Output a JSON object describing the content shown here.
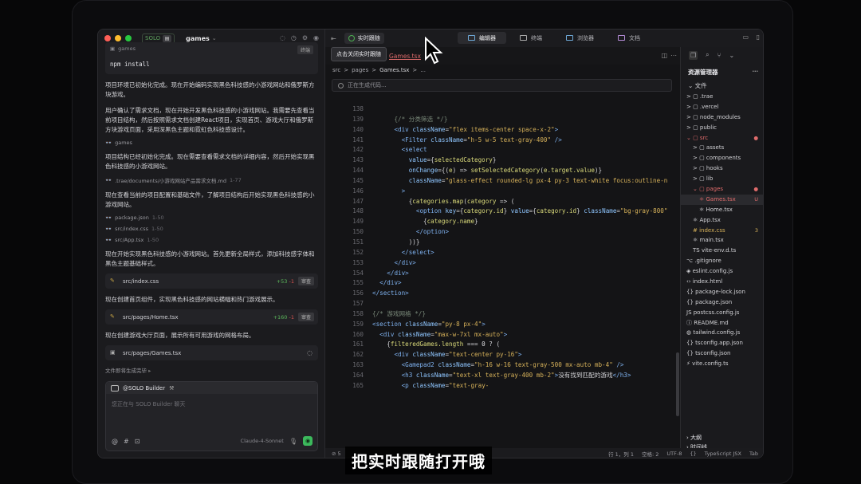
{
  "chat": {
    "title": "games",
    "solo": "SOLO",
    "code_block": {
      "label": "games",
      "copy": "终端",
      "command": "npm install"
    },
    "messages": [
      {
        "kind": "para",
        "text": "项目环境已初始化完成。现在开始编码实现黑色科技感的小游戏网站和俄罗斯方块游戏。"
      },
      {
        "kind": "para",
        "text": "用户确认了需求文档，现在开始开发黑色科技感的小游戏网站。我需要先查看当前项目结构，然后按照需求文档创建React项目，实现首页、游戏大厅和俄罗斯方块游戏页面，采用深黑色主题和霓虹色科技感设计。"
      },
      {
        "kind": "ref",
        "text": "games",
        "lines": ""
      },
      {
        "kind": "para",
        "text": "项目结构已经初始化完成。现在需要查看需求文档的详细内容，然后开始实现黑色科技感的小游戏网站。"
      },
      {
        "kind": "ref",
        "text": ".trae/documents/小游戏网站产品需求文档.md",
        "lines": "1-77"
      },
      {
        "kind": "para",
        "text": "现在查看当前的项目配置和基础文件，了解项目结构后开始实现黑色科技感的小游戏网站。"
      },
      {
        "kind": "ref",
        "text": "package.json",
        "lines": "1-50"
      },
      {
        "kind": "ref",
        "text": "src/index.css",
        "lines": "1-50"
      },
      {
        "kind": "ref",
        "text": "src/App.tsx",
        "lines": "1-50"
      },
      {
        "kind": "para",
        "text": "现在开始实现黑色科技感的小游戏网站。首先更新全局样式，添加科技感字体和黑色主题基础样式。"
      },
      {
        "kind": "file",
        "text": "src/index.css",
        "add": "+53",
        "del": "-1",
        "review": "审查"
      },
      {
        "kind": "para",
        "text": "现在创建首页组件，实现黑色科技感的网站横幅和热门游戏展示。"
      },
      {
        "kind": "file",
        "text": "src/pages/Home.tsx",
        "add": "+160",
        "del": "-1",
        "review": "审查"
      },
      {
        "kind": "para",
        "text": "现在创建游戏大厅页面，展示所有可用游戏的网格布局。"
      },
      {
        "kind": "filespin",
        "text": "src/pages/Games.tsx"
      }
    ],
    "status": "文件即将生成完毕",
    "input": {
      "agent": "@SOLO Builder",
      "placeholder": "您正在与 SOLO Builder 聊天",
      "model": "Claude-4-Sonnet",
      "at": "@",
      "hash": "#",
      "img": "⊡"
    }
  },
  "editor": {
    "follow_label": "实时跟随",
    "tooltip": "点击关闭实时跟随",
    "views": [
      "编辑器",
      "终端",
      "浏览器",
      "文档"
    ],
    "tab": "Games.tsx",
    "breadcrumb": [
      "src",
      ">",
      "pages",
      ">",
      "Games.tsx",
      ">",
      "..."
    ],
    "generating": "正在生成代码...",
    "status": {
      "left": "5",
      "pos": "行 1，列 1",
      "spaces": "空格: 2",
      "enc": "UTF-8",
      "braces": "{}",
      "lang": "TypeScript JSX",
      "tab": "Tab"
    }
  },
  "code_lines": [
    {
      "n": "138",
      "h": ""
    },
    {
      "n": "139",
      "h": "      <span class='c'>{/* 分类筛选 */}</span>"
    },
    {
      "n": "140",
      "h": "      <span class='k'>&lt;div</span> <span class='a'>className</span>=<span class='s'>\"flex items-center space-x-2\"</span><span class='k'>&gt;</span>"
    },
    {
      "n": "141",
      "h": "        <span class='k'>&lt;Filter</span> <span class='a'>className</span>=<span class='s'>\"h-5 w-5 text-gray-400\"</span> <span class='k'>/&gt;</span>"
    },
    {
      "n": "142",
      "h": "        <span class='k'>&lt;select</span>"
    },
    {
      "n": "143",
      "h": "          <span class='a'>value</span>={<span class='v'>selectedCategory</span>}"
    },
    {
      "n": "144",
      "h": "          <span class='a'>onChange</span>={(<span class='v'>e</span>) =&gt; <span class='v'>setSelectedCategory</span>(<span class='v'>e.target.value</span>)}"
    },
    {
      "n": "145",
      "h": "          <span class='a'>className</span>=<span class='s'>\"glass-effect rounded-lg px-4 py-3 text-white focus:outline-n</span>"
    },
    {
      "n": "146",
      "h": "        <span class='k'>&gt;</span>"
    },
    {
      "n": "147",
      "h": "          {<span class='v'>categories</span>.<span class='v'>map</span>(<span class='v'>category</span> =&gt; ("
    },
    {
      "n": "148",
      "h": "            <span class='k'>&lt;option</span> <span class='a'>key</span>={<span class='v'>category.id</span>} <span class='a'>value</span>={<span class='v'>category.id</span>} <span class='a'>className</span>=<span class='s'>\"bg-gray-800\"</span>"
    },
    {
      "n": "149",
      "h": "              {<span class='v'>category.name</span>}"
    },
    {
      "n": "150",
      "h": "            <span class='k'>&lt;/option&gt;</span>"
    },
    {
      "n": "151",
      "h": "          ))}"
    },
    {
      "n": "152",
      "h": "        <span class='k'>&lt;/select&gt;</span>"
    },
    {
      "n": "153",
      "h": "      <span class='k'>&lt;/div&gt;</span>"
    },
    {
      "n": "154",
      "h": "    <span class='k'>&lt;/div&gt;</span>"
    },
    {
      "n": "155",
      "h": "  <span class='k'>&lt;/div&gt;</span>"
    },
    {
      "n": "156",
      "h": "<span class='k'>&lt;/section&gt;</span>"
    },
    {
      "n": "157",
      "h": ""
    },
    {
      "n": "158",
      "h": "<span class='c'>{/* 游戏网格 */}</span>"
    },
    {
      "n": "159",
      "h": "<span class='k'>&lt;section</span> <span class='a'>className</span>=<span class='s'>\"py-8 px-4\"</span><span class='k'>&gt;</span>"
    },
    {
      "n": "160",
      "h": "  <span class='k'>&lt;div</span> <span class='a'>className</span>=<span class='s'>\"max-w-7xl mx-auto\"</span><span class='k'>&gt;</span>"
    },
    {
      "n": "161",
      "h": "    {<span class='v'>filteredGames.length</span> === <span class='w'>0</span> ? ("
    },
    {
      "n": "162",
      "h": "      <span class='k'>&lt;div</span> <span class='a'>className</span>=<span class='s'>\"text-center py-16\"</span><span class='k'>&gt;</span>"
    },
    {
      "n": "163",
      "h": "        <span class='k'>&lt;Gamepad2</span> <span class='a'>className</span>=<span class='s'>\"h-16 w-16 text-gray-500 mx-auto mb-4\"</span> <span class='k'>/&gt;</span>"
    },
    {
      "n": "164",
      "h": "        <span class='k'>&lt;h3</span> <span class='a'>className</span>=<span class='s'>\"text-xl text-gray-400 mb-2\"</span><span class='k'>&gt;</span>没有找到匹配的游戏<span class='k'>&lt;/h3&gt;</span>"
    },
    {
      "n": "165",
      "h": "        <span class='k'>&lt;p</span> <span class='a'>className</span>=<span class='s'>\"text-gray-</span>"
    }
  ],
  "explorer": {
    "title": "资源管理器",
    "section": "文件",
    "items": [
      {
        "d": 0,
        "t": "> ▢ .trae"
      },
      {
        "d": 0,
        "t": "> ▢ .vercel"
      },
      {
        "d": 0,
        "t": "> ▢ node_modules"
      },
      {
        "d": 0,
        "t": "> ▢ public"
      },
      {
        "d": 0,
        "t": "⌄ ▢ src",
        "red": true,
        "mark": "●"
      },
      {
        "d": 1,
        "t": "> ▢ assets"
      },
      {
        "d": 1,
        "t": "> ▢ components"
      },
      {
        "d": 1,
        "t": "> ▢ hooks"
      },
      {
        "d": 1,
        "t": "> ▢ lib"
      },
      {
        "d": 1,
        "t": "⌄ ▢ pages",
        "red": true,
        "mark": "●"
      },
      {
        "d": 2,
        "t": "⚛ Games.tsx",
        "red": true,
        "mark": "U",
        "sel": true
      },
      {
        "d": 2,
        "t": "⚛ Home.tsx"
      },
      {
        "d": 1,
        "t": "⚛ App.tsx"
      },
      {
        "d": 1,
        "t": "# index.css",
        "y": true,
        "mark": "3"
      },
      {
        "d": 1,
        "t": "⚛ main.tsx"
      },
      {
        "d": 1,
        "t": "TS vite-env.d.ts"
      },
      {
        "d": 0,
        "t": "⌥ .gitignore"
      },
      {
        "d": 0,
        "t": "◈ eslint.config.js"
      },
      {
        "d": 0,
        "t": "‹› index.html"
      },
      {
        "d": 0,
        "t": "{} package-lock.json"
      },
      {
        "d": 0,
        "t": "{} package.json"
      },
      {
        "d": 0,
        "t": "JS postcss.config.js"
      },
      {
        "d": 0,
        "t": "ⓘ README.md"
      },
      {
        "d": 0,
        "t": "◍ tailwind.config.js"
      },
      {
        "d": 0,
        "t": "{} tsconfig.app.json"
      },
      {
        "d": 0,
        "t": "{} tsconfig.json"
      },
      {
        "d": 0,
        "t": "⚡ vite.config.ts"
      }
    ],
    "outline": "大纲",
    "timeline": "时间线"
  },
  "caption": "把实时跟随打开哦",
  "colors": {
    "accent": "#4caf50",
    "danger": "#e06c6c",
    "bg": "#141416"
  }
}
